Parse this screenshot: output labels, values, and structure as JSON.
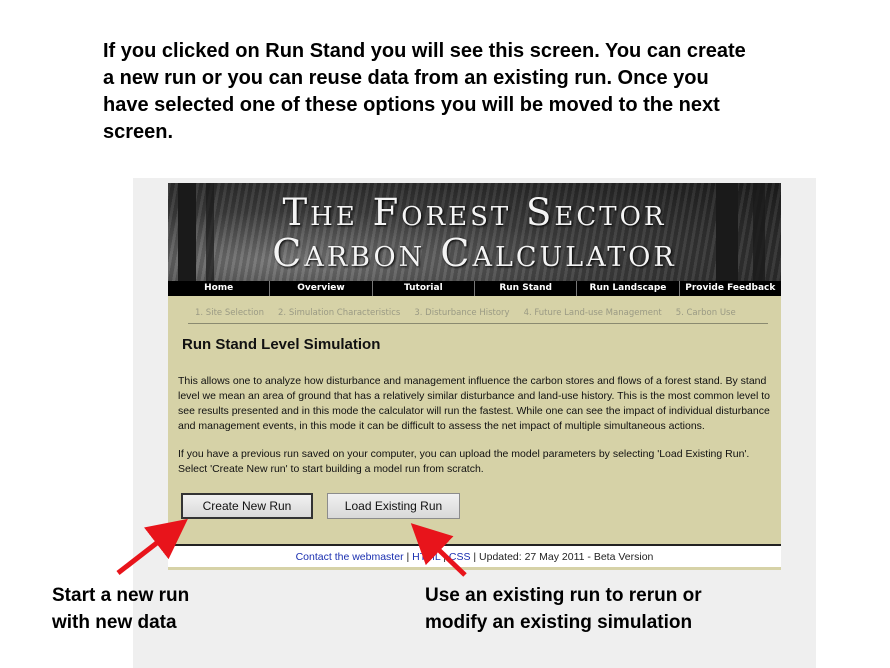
{
  "instructions": {
    "line1": "If you clicked on Run Stand you will see this screen. You can create",
    "line2": "a new run or you can reuse data from an existing run.  Once you",
    "line3": "have selected one of these options you will be moved to the next",
    "line4": "screen."
  },
  "banner": {
    "title_line1": "The Forest Sector",
    "title_line2": "Carbon Calculator"
  },
  "nav": [
    "Home",
    "Overview",
    "Tutorial",
    "Run Stand",
    "Run Landscape",
    "Provide Feedback"
  ],
  "steps": [
    "1. Site Selection",
    "2. Simulation Characteristics",
    "3. Disturbance History",
    "4. Future Land-use Management",
    "5. Carbon Use"
  ],
  "page": {
    "heading": "Run Stand Level Simulation",
    "paragraph1": "This allows one to analyze how disturbance and management influence the carbon stores and flows of a forest stand. By stand level we mean an area of ground that has a relatively similar disturbance and land-use history. This is the most common level to see results presented and in this mode the calculator will run the fastest. While one can see the impact of individual disturbance and management events, in this mode it can be difficult to assess the net impact of multiple simultaneous actions.",
    "paragraph2": "If you have a previous run saved on your computer, you can upload the model parameters by selecting 'Load Existing Run'. Select 'Create New run' to start building a model run from scratch."
  },
  "buttons": {
    "create": "Create New Run",
    "load": "Load Existing Run"
  },
  "footer": {
    "contact": "Contact the webmaster",
    "sep1": " | ",
    "html": "HTML",
    "sep2": " | ",
    "css": "CSS",
    "updated": " | Updated: 27 May 2011 - Beta Version"
  },
  "callouts": {
    "left_line1": "Start a new run",
    "left_line2": "with new data",
    "right_line1": "Use an existing run to rerun or",
    "right_line2": "modify an existing simulation"
  },
  "colors": {
    "arrow": "#e8141b",
    "site_background": "#d6d2a7",
    "link": "#1a2fb0"
  },
  "icons": [
    "red-arrow-icon"
  ]
}
